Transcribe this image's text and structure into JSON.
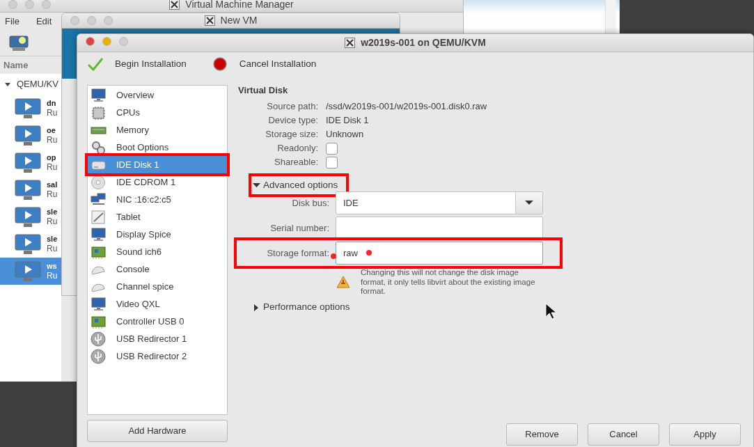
{
  "manager_window": {
    "title": "Virtual Machine Manager",
    "menu": [
      "File",
      "Edit"
    ],
    "column_header": "Name",
    "connection": {
      "label": "QEMU/KV",
      "expanded": true
    },
    "vms": [
      {
        "name": "dn",
        "status": "Ru",
        "selected": false
      },
      {
        "name": "oe",
        "status": "Ru",
        "selected": false
      },
      {
        "name": "op",
        "status": "Ru",
        "selected": false
      },
      {
        "name": "sal",
        "status": "Ru",
        "selected": false
      },
      {
        "name": "sle",
        "status": "Ru",
        "selected": false
      },
      {
        "name": "sle",
        "status": "Ru",
        "selected": false
      },
      {
        "name": "ws",
        "status": "Ru",
        "selected": true
      }
    ]
  },
  "new_vm_window": {
    "title": "New VM"
  },
  "dialog": {
    "title": "w2019s-001 on QEMU/KVM",
    "toolbar": [
      {
        "kind": "begin",
        "label": "Begin Installation"
      },
      {
        "kind": "cancel",
        "label": "Cancel Installation"
      }
    ],
    "hardware": [
      {
        "label": "Overview",
        "kind": "monitor",
        "selected": false,
        "highlighted": false
      },
      {
        "label": "CPUs",
        "kind": "cpu",
        "selected": false,
        "highlighted": false
      },
      {
        "label": "Memory",
        "kind": "memory",
        "selected": false,
        "highlighted": false
      },
      {
        "label": "Boot Options",
        "kind": "boot",
        "selected": false,
        "highlighted": false
      },
      {
        "label": "IDE Disk 1",
        "kind": "disk",
        "selected": true,
        "highlighted": true
      },
      {
        "label": "IDE CDROM 1",
        "kind": "cdrom",
        "selected": false,
        "highlighted": false
      },
      {
        "label": "NIC :16:c2:c5",
        "kind": "nic",
        "selected": false,
        "highlighted": false
      },
      {
        "label": "Tablet",
        "kind": "tablet",
        "selected": false,
        "highlighted": false
      },
      {
        "label": "Display Spice",
        "kind": "monitor",
        "selected": false,
        "highlighted": false
      },
      {
        "label": "Sound ich6",
        "kind": "card",
        "selected": false,
        "highlighted": false
      },
      {
        "label": "Console",
        "kind": "console",
        "selected": false,
        "highlighted": false
      },
      {
        "label": "Channel spice",
        "kind": "console",
        "selected": false,
        "highlighted": false
      },
      {
        "label": "Video QXL",
        "kind": "monitor",
        "selected": false,
        "highlighted": false
      },
      {
        "label": "Controller USB 0",
        "kind": "card",
        "selected": false,
        "highlighted": false
      },
      {
        "label": "USB Redirector 1",
        "kind": "usb",
        "selected": false,
        "highlighted": false
      },
      {
        "label": "USB Redirector 2",
        "kind": "usb",
        "selected": false,
        "highlighted": false
      }
    ],
    "add_button": "Add Hardware",
    "section_title": "Virtual Disk",
    "details": [
      {
        "label": "Source path:",
        "value": "/ssd/w2019s-001/w2019s-001.disk0.raw"
      },
      {
        "label": "Device type:",
        "value": "IDE Disk 1"
      },
      {
        "label": "Storage size:",
        "value": "Unknown"
      }
    ],
    "checks": [
      {
        "label": "Readonly:",
        "checked": false
      },
      {
        "label": "Shareable:",
        "checked": false
      }
    ],
    "advanced": {
      "label": "Advanced options",
      "expanded": true,
      "highlighted": true,
      "disk_bus": {
        "label": "Disk bus:",
        "value": "IDE"
      },
      "serial_number": {
        "label": "Serial number:"
      },
      "storage_format": {
        "label": "Storage format:",
        "value": "raw",
        "highlighted": true,
        "marked": true
      },
      "warning": "Changing this will not change the disk image format, it only tells libvirt about the existing image format."
    },
    "performance": {
      "label": "Performance options",
      "expanded": false
    },
    "buttons": [
      "Remove",
      "Cancel",
      "Apply"
    ]
  }
}
